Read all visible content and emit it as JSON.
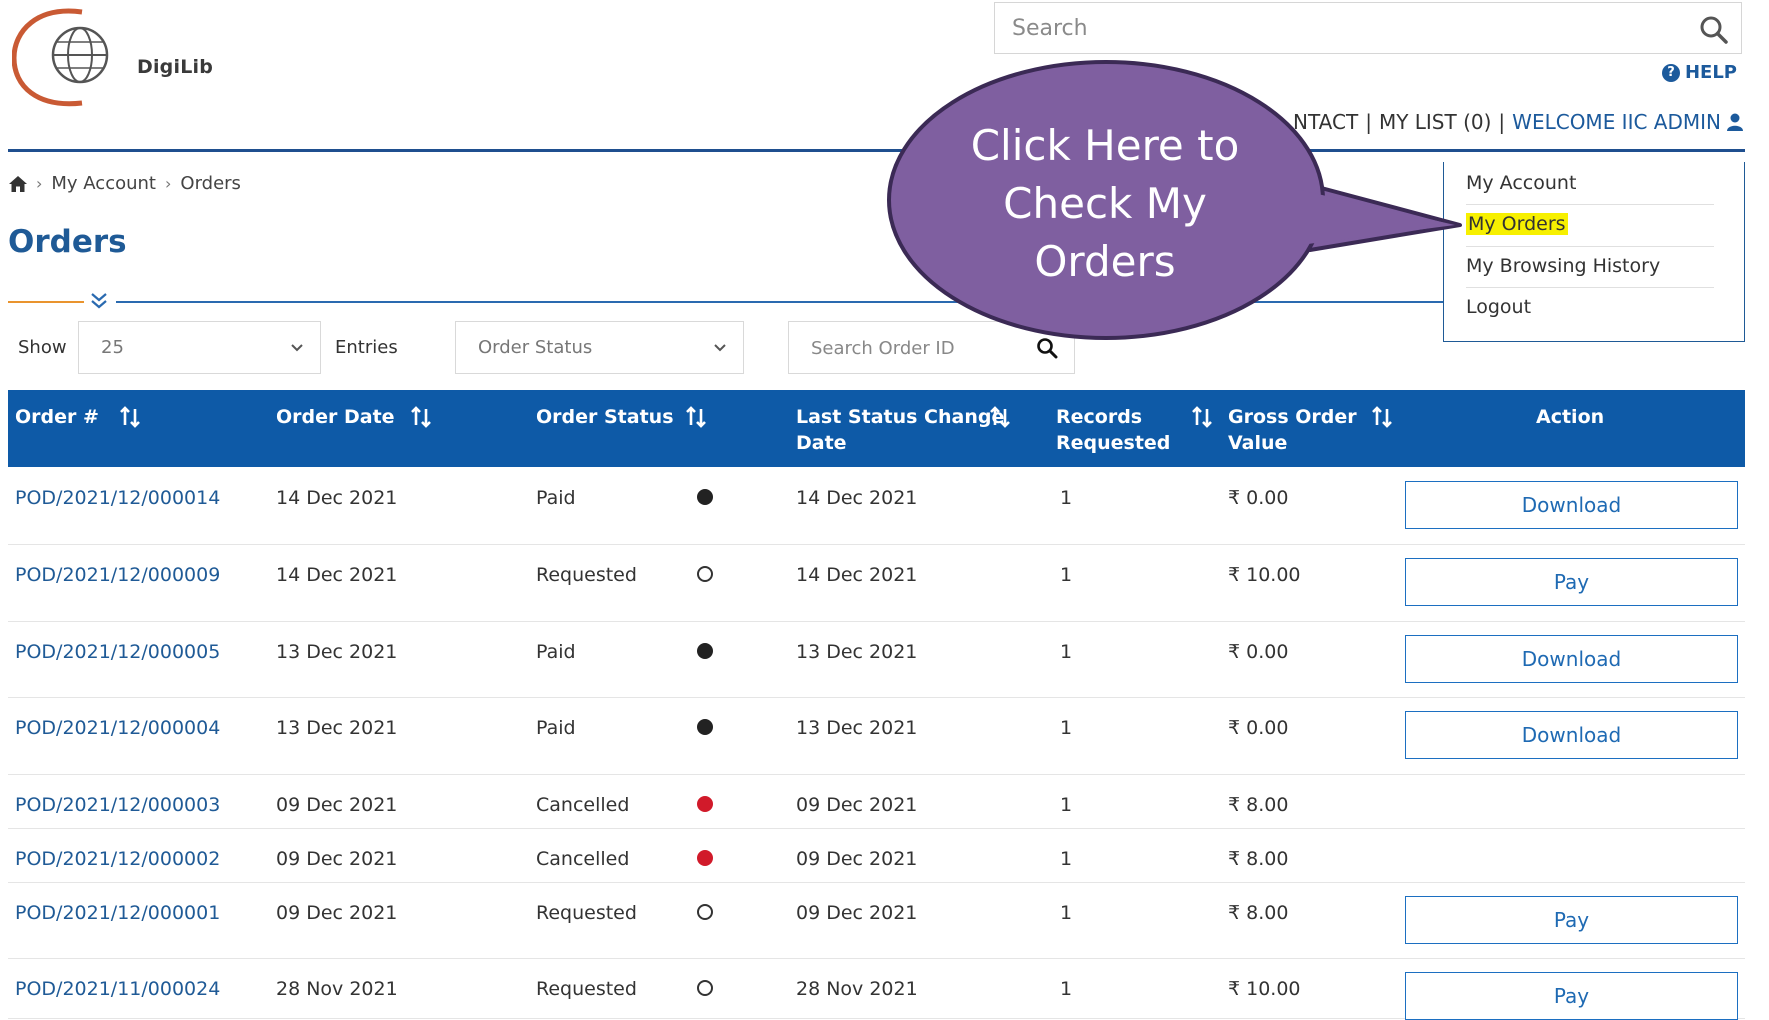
{
  "logo": {
    "text": "DigiLib"
  },
  "search": {
    "placeholder": "Search"
  },
  "header": {
    "help": "HELP",
    "nav_contact": "NTACT",
    "nav_mylist": "MY LIST (0)",
    "nav_welcome": "WELCOME IIC ADMIN"
  },
  "breadcrumb": {
    "account": "My Account",
    "current": "Orders"
  },
  "page": {
    "title": "Orders"
  },
  "filters": {
    "show_label": "Show",
    "page_size": "25",
    "entries_label": "Entries",
    "status_placeholder": "Order Status",
    "order_search_placeholder": "Search Order ID"
  },
  "menu": {
    "items": [
      "My Account",
      "My Orders",
      "My Browsing History",
      "Logout"
    ],
    "highlighted": "My Orders"
  },
  "callout": {
    "line1": "Click Here to",
    "line2": "Check My",
    "line3": "Orders"
  },
  "table": {
    "headers": {
      "order_no": "Order #",
      "order_date": "Order Date",
      "order_status": "Order Status",
      "last_change_1": "Last Status Change",
      "last_change_2": "Date",
      "records_1": "Records",
      "records_2": "Requested",
      "gross_1": "Gross Order",
      "gross_2": "Value",
      "action": "Action"
    },
    "rows": [
      {
        "order_id": "POD/2021/12/000014",
        "order_date": "14 Dec 2021",
        "status": "Paid",
        "status_dot": "paid",
        "last_change": "14 Dec 2021",
        "records": "1",
        "value": "₹ 0.00",
        "action": "Download"
      },
      {
        "order_id": "POD/2021/12/000009",
        "order_date": "14 Dec 2021",
        "status": "Requested",
        "status_dot": "requested",
        "last_change": "14 Dec 2021",
        "records": "1",
        "value": "₹ 10.00",
        "action": "Pay"
      },
      {
        "order_id": "POD/2021/12/000005",
        "order_date": "13 Dec 2021",
        "status": "Paid",
        "status_dot": "paid",
        "last_change": "13 Dec 2021",
        "records": "1",
        "value": "₹ 0.00",
        "action": "Download"
      },
      {
        "order_id": "POD/2021/12/000004",
        "order_date": "13 Dec 2021",
        "status": "Paid",
        "status_dot": "paid",
        "last_change": "13 Dec 2021",
        "records": "1",
        "value": "₹ 0.00",
        "action": "Download"
      },
      {
        "order_id": "POD/2021/12/000003",
        "order_date": "09 Dec 2021",
        "status": "Cancelled",
        "status_dot": "cancelled",
        "last_change": "09 Dec 2021",
        "records": "1",
        "value": "₹ 8.00",
        "action": ""
      },
      {
        "order_id": "POD/2021/12/000002",
        "order_date": "09 Dec 2021",
        "status": "Cancelled",
        "status_dot": "cancelled",
        "last_change": "09 Dec 2021",
        "records": "1",
        "value": "₹ 8.00",
        "action": ""
      },
      {
        "order_id": "POD/2021/12/000001",
        "order_date": "09 Dec 2021",
        "status": "Requested",
        "status_dot": "requested",
        "last_change": "09 Dec 2021",
        "records": "1",
        "value": "₹ 8.00",
        "action": "Pay"
      },
      {
        "order_id": "POD/2021/11/000024",
        "order_date": "28 Nov 2021",
        "status": "Requested",
        "status_dot": "requested",
        "last_change": "28 Nov 2021",
        "records": "1",
        "value": "₹ 10.00",
        "action": "Pay"
      }
    ]
  },
  "colors": {
    "brand_blue": "#1f5a96",
    "header_blue": "#0e5aa7",
    "accent_orange": "#e9942e",
    "callout_purple": "#7f5fa0",
    "highlight_yellow": "#f7f000",
    "cancelled_red": "#d11a2a"
  }
}
